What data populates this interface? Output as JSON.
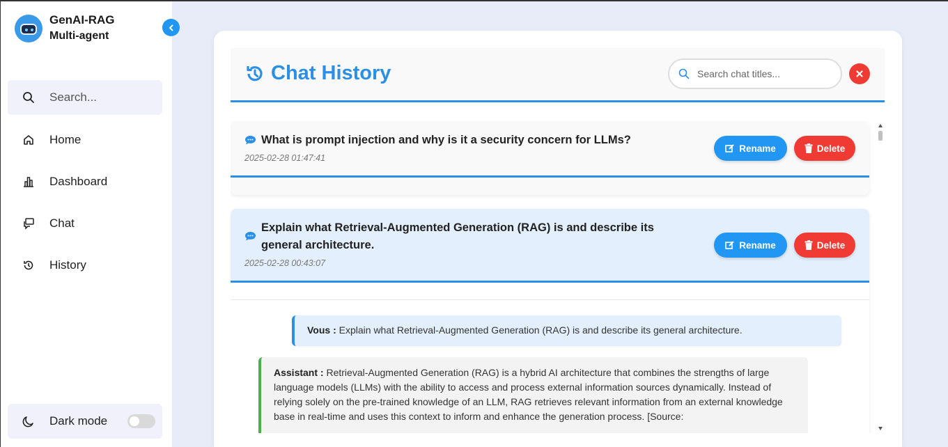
{
  "sidebar": {
    "brand_title": "GenAI-RAG",
    "brand_subtitle": "Multi-agent",
    "search_label": "Search...",
    "items": [
      {
        "label": "Home",
        "icon": "home-icon"
      },
      {
        "label": "Dashboard",
        "icon": "chart-icon"
      },
      {
        "label": "Chat",
        "icon": "chat-icon"
      },
      {
        "label": "History",
        "icon": "history-icon"
      }
    ],
    "dark_mode_label": "Dark mode",
    "dark_mode_enabled": false
  },
  "header": {
    "title": "Chat History",
    "search_placeholder": "Search chat titles..."
  },
  "chats": [
    {
      "title": "What is prompt injection and why is it a security concern for LLMs?",
      "date": "2025-02-28 01:47:41",
      "rename_label": "Rename",
      "delete_label": "Delete"
    },
    {
      "title": "Explain what Retrieval-Augmented Generation (RAG) is and describe its general architecture.",
      "date": "2025-02-28 00:43:07",
      "rename_label": "Rename",
      "delete_label": "Delete"
    }
  ],
  "conversation": {
    "user_prefix": "Vous :",
    "user_text": "Explain what Retrieval-Augmented Generation (RAG) is and describe its general architecture.",
    "assistant_prefix": "Assistant :",
    "assistant_text": "Retrieval-Augmented Generation (RAG) is a hybrid AI architecture that combines the strengths of large language models (LLMs) with the ability to access and process external information sources dynamically. Instead of relying solely on the pre-trained knowledge of an LLM, RAG retrieves relevant information from an external knowledge base in real-time and uses this context to inform and enhance the generation process. [Source:"
  },
  "colors": {
    "accent": "#2b8fe5",
    "danger": "#ef3b34",
    "success": "#4caf50",
    "background": "#e8ecf8"
  }
}
